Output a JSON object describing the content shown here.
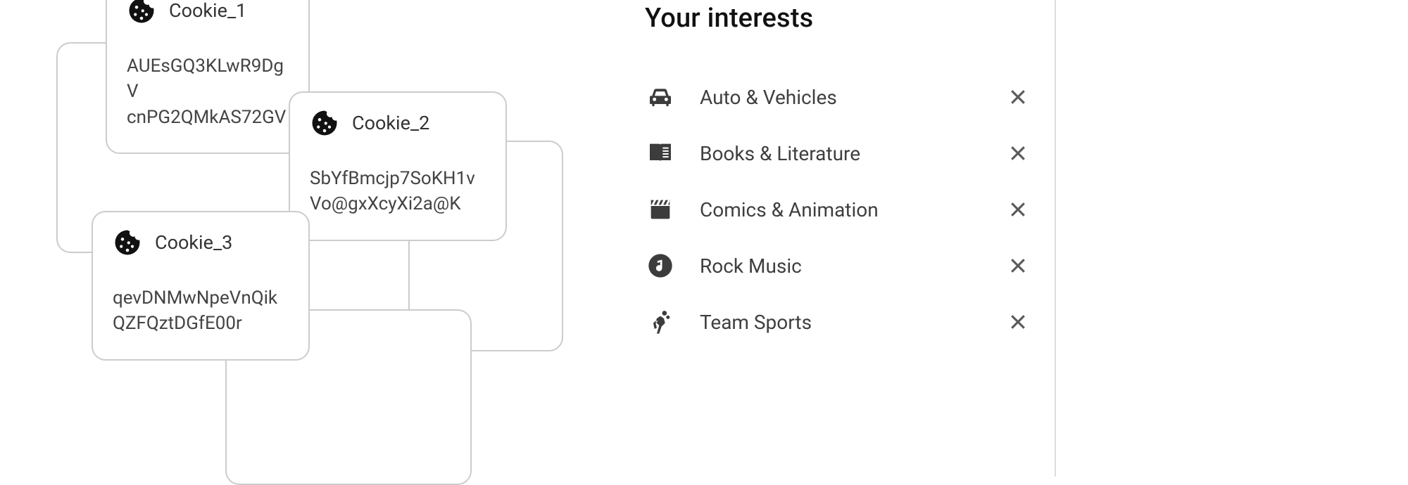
{
  "cookies": [
    {
      "title": "Cookie_1",
      "line1": "AUEsGQ3KLwR9DgV",
      "line2": "cnPG2QMkAS72GV"
    },
    {
      "title": "Cookie_2",
      "line1": "SbYfBmcjp7SoKH1v",
      "line2": "Vo@gxXcyXi2a@K"
    },
    {
      "title": "Cookie_3",
      "line1": "qevDNMwNpeVnQik",
      "line2": "QZFQztDGfE00r"
    }
  ],
  "interests": {
    "heading": "Your interests",
    "items": [
      {
        "icon": "car-icon",
        "label": "Auto & Vehicles"
      },
      {
        "icon": "book-icon",
        "label": "Books & Literature"
      },
      {
        "icon": "clapper-icon",
        "label": "Comics & Animation"
      },
      {
        "icon": "music-icon",
        "label": "Rock Music"
      },
      {
        "icon": "sports-icon",
        "label": "Team Sports"
      }
    ]
  }
}
